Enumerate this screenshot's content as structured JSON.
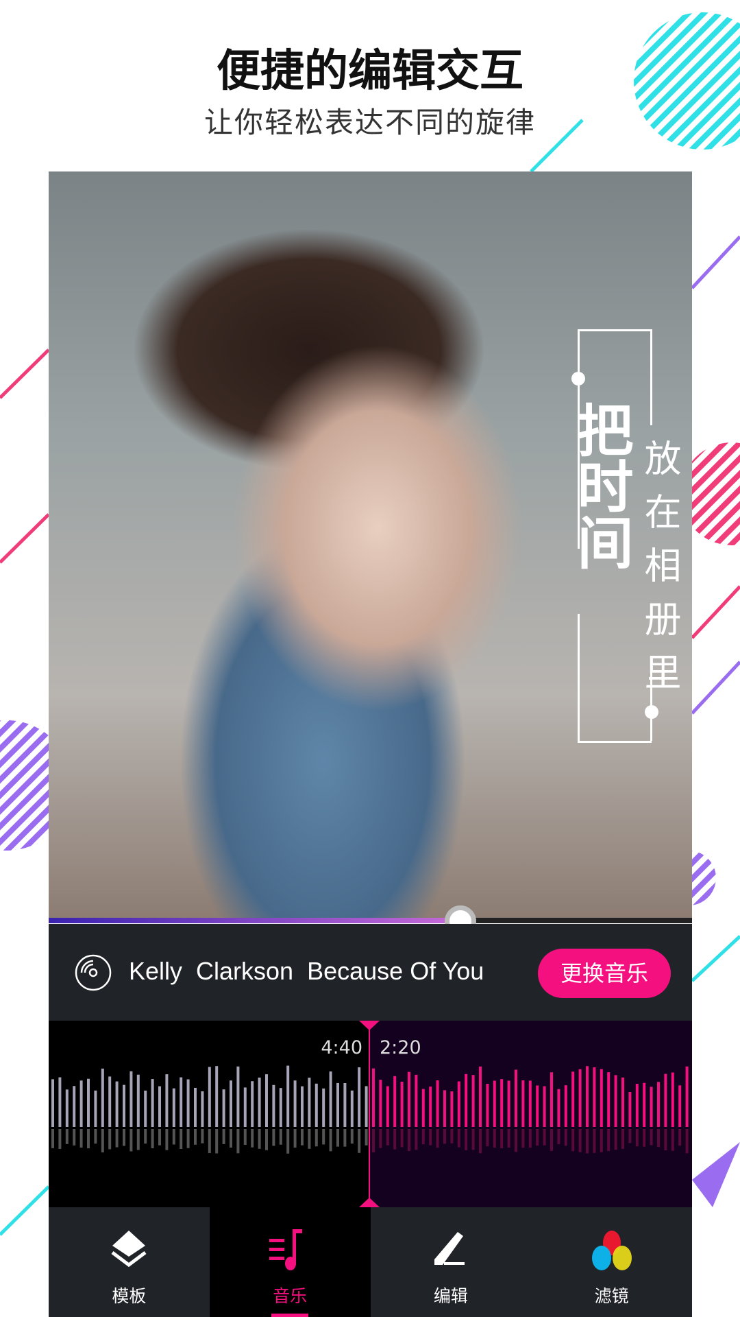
{
  "header": {
    "title": "便捷的编辑交互",
    "subtitle": "让你轻松表达不同的旋律"
  },
  "overlay": {
    "main_text": "把时间",
    "side_text": "放在相册里"
  },
  "player": {
    "progress_percent": 64,
    "artist": "Kelly  Clarkson",
    "song": "Because Of You",
    "change_music_label": "更换音乐",
    "elapsed": "4:40",
    "remaining": "2:20"
  },
  "tabs": [
    {
      "label": "模板",
      "icon": "layers-icon"
    },
    {
      "label": "音乐",
      "icon": "music-note-icon",
      "active": true
    },
    {
      "label": "编辑",
      "icon": "pencil-icon"
    },
    {
      "label": "滤镜",
      "icon": "color-filter-icon"
    }
  ],
  "colors": {
    "accent": "#f5107f",
    "cyan": "#2fe0e6",
    "purple": "#9a6cf0",
    "pink": "#f03c78",
    "panel": "#202328"
  }
}
